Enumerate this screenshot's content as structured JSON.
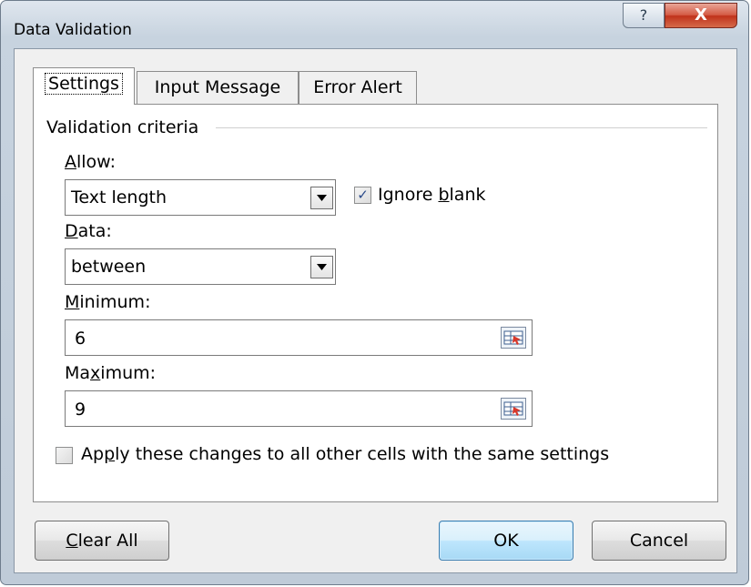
{
  "window": {
    "title": "Data Validation",
    "help_glyph": "?",
    "close_glyph": "X"
  },
  "tabs": [
    {
      "label": "Settings",
      "active": true
    },
    {
      "label": "Input Message",
      "active": false
    },
    {
      "label": "Error Alert",
      "active": false
    }
  ],
  "criteria": {
    "group_label": "Validation criteria",
    "allow": {
      "label_mnemonic": "A",
      "label_rest": "llow:",
      "value": "Text length",
      "dropdown_icon": "chevron-down"
    },
    "ignore_blank": {
      "checked": true,
      "label_before": "Ignore ",
      "label_mnemonic": "b",
      "label_after": "lank"
    },
    "data": {
      "label_mnemonic": "D",
      "label_rest": "ata:",
      "value": "between",
      "dropdown_icon": "chevron-down"
    },
    "minimum": {
      "label_mnemonic": "M",
      "label_rest": "inimum:",
      "value": "6"
    },
    "maximum": {
      "label_before": "Ma",
      "label_mnemonic": "x",
      "label_after": "imum:",
      "value": "9"
    }
  },
  "apply_all": {
    "checked": false,
    "label_before": "Ap",
    "label_mnemonic": "p",
    "label_after": "ly these changes to all other cells with the same settings"
  },
  "buttons": {
    "clear_mnemonic": "C",
    "clear_rest": "lear All",
    "ok": "OK",
    "cancel": "Cancel"
  },
  "colors": {
    "close_button": "#c0321b",
    "default_button_border": "#3c7fb1",
    "checkmark": "#2a4a8a"
  }
}
